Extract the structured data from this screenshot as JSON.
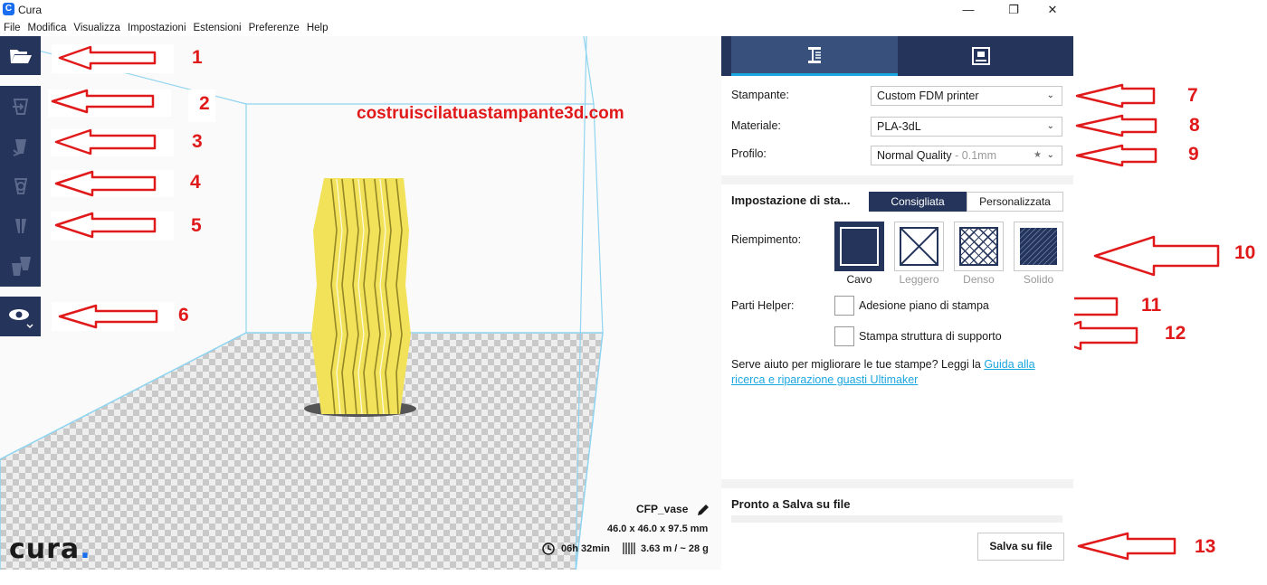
{
  "window": {
    "title": "Cura",
    "app_icon": "C",
    "controls": [
      "minimize-icon",
      "restore-icon",
      "close-icon"
    ]
  },
  "menu": [
    "File",
    "Modifica",
    "Visualizza",
    "Impostazioni",
    "Estensioni",
    "Preferenze",
    "Help"
  ],
  "watermark": "costruiscilatuastampante3d.com",
  "annotations": [
    "1",
    "2",
    "3",
    "4",
    "5",
    "6",
    "7",
    "8",
    "9",
    "10",
    "11",
    "12",
    "13"
  ],
  "logo": {
    "text": "cura",
    "dot": "."
  },
  "job": {
    "name": "CFP_vase",
    "dimensions": "46.0 x 46.0 x 97.5 mm",
    "time": "06h 32min",
    "material": "3.63 m / ~ 28 g"
  },
  "panel": {
    "printer_label": "Stampante:",
    "printer_value": "Custom FDM printer",
    "material_label": "Materiale:",
    "material_value": "PLA-3dL",
    "profile_label": "Profilo:",
    "profile_value": "Normal Quality",
    "profile_suffix": " - 0.1mm",
    "settings_title": "Impostazione di sta...",
    "mode_recommended": "Consigliata",
    "mode_custom": "Personalizzata",
    "infill_label": "Riempimento:",
    "infill_options": [
      "Cavo",
      "Leggero",
      "Denso",
      "Solido"
    ],
    "helpers_label": "Parti Helper:",
    "adhesion_label": "Adesione piano di stampa",
    "support_label": "Stampa struttura di supporto",
    "help_text": "Serve aiuto per migliorare le tue stampe? Leggi la ",
    "help_link": "Guida alla ricerca e riparazione guasti Ultimaker",
    "save_title": "Pronto a Salva su file",
    "save_button": "Salva su file"
  },
  "colors": {
    "accent": "#24345a",
    "highlight": "#1ca6e0",
    "annotation": "#e01a1a",
    "model": "#f2e25a"
  }
}
